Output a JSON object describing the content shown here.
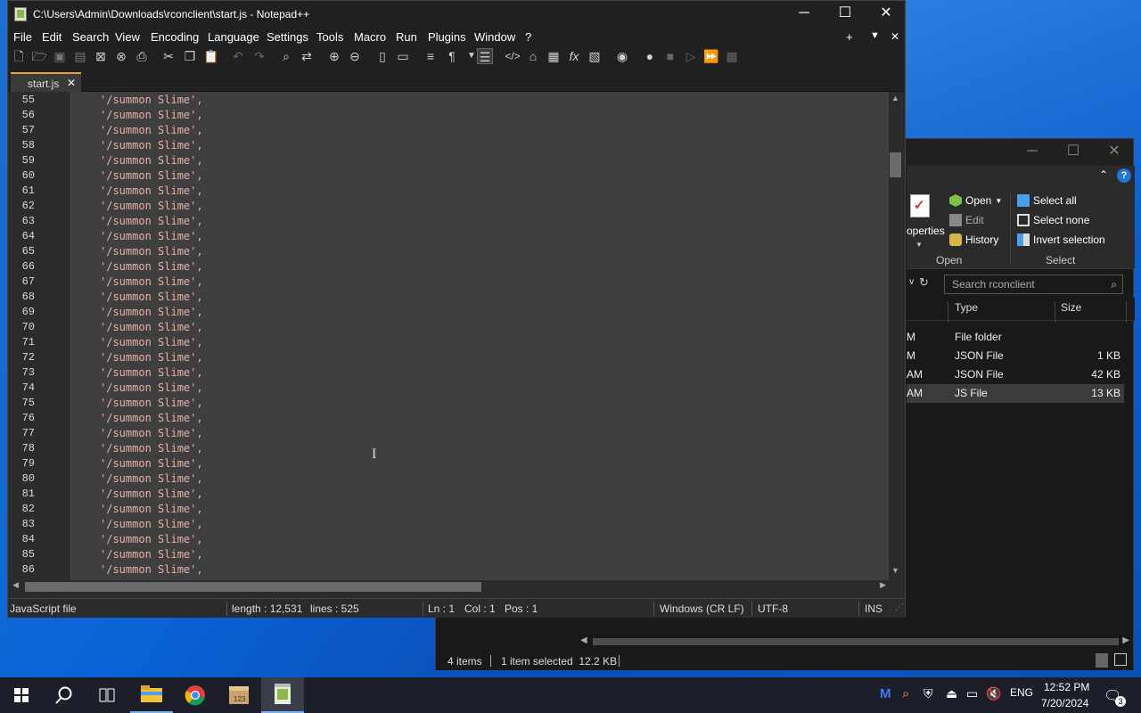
{
  "notepad": {
    "title": "C:\\Users\\Admin\\Downloads\\rconclient\\start.js - Notepad++",
    "menu": [
      "File",
      "Edit",
      "Search",
      "View",
      "Encoding",
      "Language",
      "Settings",
      "Tools",
      "Macro",
      "Run",
      "Plugins",
      "Window",
      "?"
    ],
    "menu_right": [
      "+",
      "▼",
      "✕"
    ],
    "tab": {
      "label": "start.js",
      "close": "✕"
    },
    "line_numbers": [
      "55",
      "56",
      "57",
      "58",
      "59",
      "60",
      "61",
      "62",
      "63",
      "64",
      "65",
      "66",
      "67",
      "68",
      "69",
      "70",
      "71",
      "72",
      "73",
      "74",
      "75",
      "76",
      "77",
      "78",
      "79",
      "80",
      "81",
      "82",
      "83",
      "84",
      "85",
      "86"
    ],
    "line_text": "'/summon Slime',",
    "status": {
      "type": "JavaScript file",
      "length": "length : 12,531",
      "lines": "lines : 525",
      "ln": "Ln : 1",
      "col": "Col : 1",
      "pos": "Pos : 1",
      "eol": "Windows (CR LF)",
      "encoding": "UTF-8",
      "mode": "INS"
    }
  },
  "explorer": {
    "ribbon": {
      "properties": "operties",
      "open": "Open",
      "edit": "Edit",
      "history": "History",
      "select_all": "Select all",
      "select_none": "Select none",
      "invert_selection": "Invert selection",
      "group_open": "Open",
      "group_select": "Select"
    },
    "search_placeholder": "Search rconclient",
    "columns": {
      "type": "Type",
      "size": "Size"
    },
    "rows": [
      {
        "frag": "M",
        "type": "File folder",
        "size": ""
      },
      {
        "frag": "M",
        "type": "JSON File",
        "size": "1 KB"
      },
      {
        "frag": "AM",
        "type": "JSON File",
        "size": "42 KB"
      },
      {
        "frag": "AM",
        "type": "JS File",
        "size": "13 KB"
      }
    ],
    "status": {
      "items": "4 items",
      "selected": "1 item selected  12.2 KB"
    }
  },
  "taskbar": {
    "lang": "ENG",
    "time": "12:52 PM",
    "date": "7/20/2024",
    "notif_count": "3"
  },
  "colors": {
    "accent_tab": "#e8a23a",
    "string_text": "#e6b0a8"
  }
}
